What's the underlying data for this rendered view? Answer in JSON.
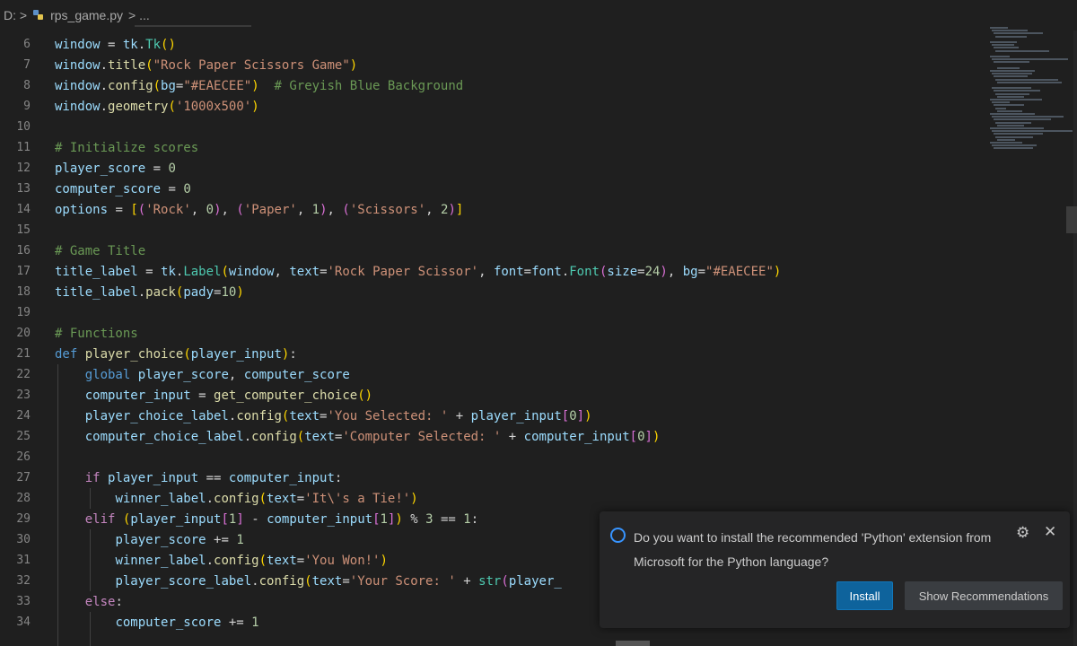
{
  "breadcrumb": {
    "prefix": "D: >",
    "file": "rps_game.py",
    "tail": "> ..."
  },
  "editor": {
    "lines": [
      {
        "n": "6",
        "html": "<span class='var'>window</span> = <span class='var'>tk</span>.<span class='cls'>Tk</span><span class='br1'>()</span>"
      },
      {
        "n": "7",
        "html": "<span class='var'>window</span>.<span class='fn'>title</span><span class='br1'>(</span><span class='str'>\"Rock Paper Scissors Game\"</span><span class='br1'>)</span>"
      },
      {
        "n": "8",
        "html": "<span class='var'>window</span>.<span class='fn'>config</span><span class='br1'>(</span><span class='var'>bg</span>=<span class='str'>\"#EAECEE\"</span><span class='br1'>)</span>  <span class='com'># Greyish Blue Background</span>"
      },
      {
        "n": "9",
        "html": "<span class='var'>window</span>.<span class='fn'>geometry</span><span class='br1'>(</span><span class='str'>'1000x500'</span><span class='br1'>)</span>"
      },
      {
        "n": "10",
        "html": ""
      },
      {
        "n": "11",
        "html": "<span class='com'># Initialize scores</span>"
      },
      {
        "n": "12",
        "html": "<span class='var'>player_score</span> = <span class='num'>0</span>"
      },
      {
        "n": "13",
        "html": "<span class='var'>computer_score</span> = <span class='num'>0</span>"
      },
      {
        "n": "14",
        "html": "<span class='var'>options</span> = <span class='br1'>[</span><span class='br2'>(</span><span class='str'>'Rock'</span>, <span class='num'>0</span><span class='br2'>)</span>, <span class='br2'>(</span><span class='str'>'Paper'</span>, <span class='num'>1</span><span class='br2'>)</span>, <span class='br2'>(</span><span class='str'>'Scissors'</span>, <span class='num'>2</span><span class='br2'>)</span><span class='br1'>]</span>"
      },
      {
        "n": "15",
        "html": ""
      },
      {
        "n": "16",
        "html": "<span class='com'># Game Title</span>"
      },
      {
        "n": "17",
        "html": "<span class='var'>title_label</span> = <span class='var'>tk</span>.<span class='cls'>Label</span><span class='br1'>(</span><span class='var'>window</span>, <span class='var'>text</span>=<span class='str'>'Rock Paper Scissor'</span>, <span class='var'>font</span>=<span class='var'>font</span>.<span class='cls'>Font</span><span class='br2'>(</span><span class='var'>size</span>=<span class='num'>24</span><span class='br2'>)</span>, <span class='var'>bg</span>=<span class='str'>\"#EAECEE\"</span><span class='br1'>)</span>"
      },
      {
        "n": "18",
        "html": "<span class='var'>title_label</span>.<span class='fn'>pack</span><span class='br1'>(</span><span class='var'>pady</span>=<span class='num'>10</span><span class='br1'>)</span>"
      },
      {
        "n": "19",
        "html": ""
      },
      {
        "n": "20",
        "html": "<span class='com'># Functions</span>"
      },
      {
        "n": "21",
        "html": "<span class='kw'>def</span> <span class='fn'>player_choice</span><span class='br1'>(</span><span class='var'>player_input</span><span class='br1'>)</span>:"
      },
      {
        "n": "22",
        "html": "    <span class='kw'>global</span> <span class='var'>player_score</span>, <span class='var'>computer_score</span>"
      },
      {
        "n": "23",
        "html": "    <span class='var'>computer_input</span> = <span class='fn'>get_computer_choice</span><span class='br1'>()</span>"
      },
      {
        "n": "24",
        "html": "    <span class='var'>player_choice_label</span>.<span class='fn'>config</span><span class='br1'>(</span><span class='var'>text</span>=<span class='str'>'You Selected: '</span> + <span class='var'>player_input</span><span class='br2'>[</span><span class='num'>0</span><span class='br2'>]</span><span class='br1'>)</span>"
      },
      {
        "n": "25",
        "html": "    <span class='var'>computer_choice_label</span>.<span class='fn'>config</span><span class='br1'>(</span><span class='var'>text</span>=<span class='str'>'Computer Selected: '</span> + <span class='var'>computer_input</span><span class='br2'>[</span><span class='num'>0</span><span class='br2'>]</span><span class='br1'>)</span>"
      },
      {
        "n": "26",
        "html": ""
      },
      {
        "n": "27",
        "html": "    <span class='ctl'>if</span> <span class='var'>player_input</span> == <span class='var'>computer_input</span>:"
      },
      {
        "n": "28",
        "html": "        <span class='var'>winner_label</span>.<span class='fn'>config</span><span class='br1'>(</span><span class='var'>text</span>=<span class='str'>'It\\'s a Tie!'</span><span class='br1'>)</span>"
      },
      {
        "n": "29",
        "html": "    <span class='ctl'>elif</span> <span class='br1'>(</span><span class='var'>player_input</span><span class='br2'>[</span><span class='num'>1</span><span class='br2'>]</span> - <span class='var'>computer_input</span><span class='br2'>[</span><span class='num'>1</span><span class='br2'>]</span><span class='br1'>)</span> % <span class='num'>3</span> == <span class='num'>1</span>:"
      },
      {
        "n": "30",
        "html": "        <span class='var'>player_score</span> += <span class='num'>1</span>"
      },
      {
        "n": "31",
        "html": "        <span class='var'>winner_label</span>.<span class='fn'>config</span><span class='br1'>(</span><span class='var'>text</span>=<span class='str'>'You Won!'</span><span class='br1'>)</span>"
      },
      {
        "n": "32",
        "html": "        <span class='var'>player_score_label</span>.<span class='fn'>config</span><span class='br1'>(</span><span class='var'>text</span>=<span class='str'>'Your Score: '</span> + <span class='cls'>str</span><span class='br2'>(</span><span class='var'>player_</span>"
      },
      {
        "n": "33",
        "html": "    <span class='ctl'>else</span>:"
      },
      {
        "n": "34",
        "html": "        <span class='var'>computer_score</span> += <span class='num'>1</span>"
      }
    ]
  },
  "notification": {
    "message": "Do you want to install the recommended 'Python' extension from Microsoft for the Python language?",
    "install_label": "Install",
    "recommendations_label": "Show Recommendations"
  },
  "icons": {
    "info": "info-circle-icon",
    "gear": "gear-icon",
    "close": "close-icon"
  },
  "colors": {
    "editor_bg": "#1f1f1f",
    "keyword": "#569cd6",
    "function": "#dcdcaa",
    "variable": "#9cdcfe",
    "string": "#ce9178",
    "comment": "#6a9955",
    "button_primary": "#0e639c"
  }
}
